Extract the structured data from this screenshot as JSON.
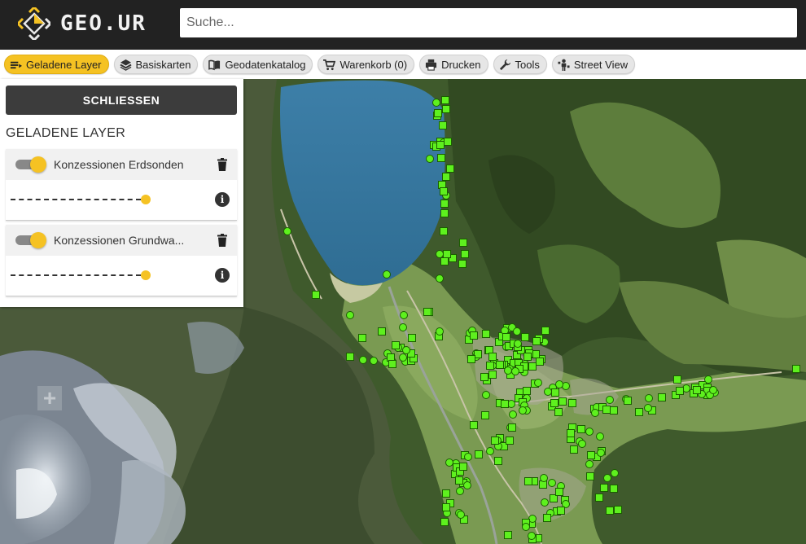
{
  "header": {
    "logo_text": "GEO.UR",
    "search_placeholder": "Suche..."
  },
  "toolbar": {
    "items": [
      {
        "label": "Geladene Layer",
        "icon": "layers-list-icon",
        "active": true
      },
      {
        "label": "Basiskarten",
        "icon": "stack-icon",
        "active": false
      },
      {
        "label": "Geodatenkatalog",
        "icon": "book-icon",
        "active": false
      },
      {
        "label": "Warenkorb (0)",
        "icon": "cart-icon",
        "active": false
      },
      {
        "label": "Drucken",
        "icon": "printer-icon",
        "active": false
      },
      {
        "label": "Tools",
        "icon": "wrench-icon",
        "active": false
      },
      {
        "label": "Street View",
        "icon": "pegman-icon",
        "active": false
      }
    ]
  },
  "sidebar": {
    "close_label": "SCHLIESSEN",
    "title": "GELADENE LAYER",
    "layers": [
      {
        "name": "Konzessionen Erdsonden",
        "visible": true,
        "opacity": 1.0
      },
      {
        "name": "Konzessionen Grundwa...",
        "visible": true,
        "opacity": 1.0
      }
    ]
  },
  "map": {
    "zoom_in_label": "+",
    "colors": {
      "point": "#5ef01e",
      "point_stroke": "#1b5e00",
      "accent": "#f5c223"
    }
  }
}
